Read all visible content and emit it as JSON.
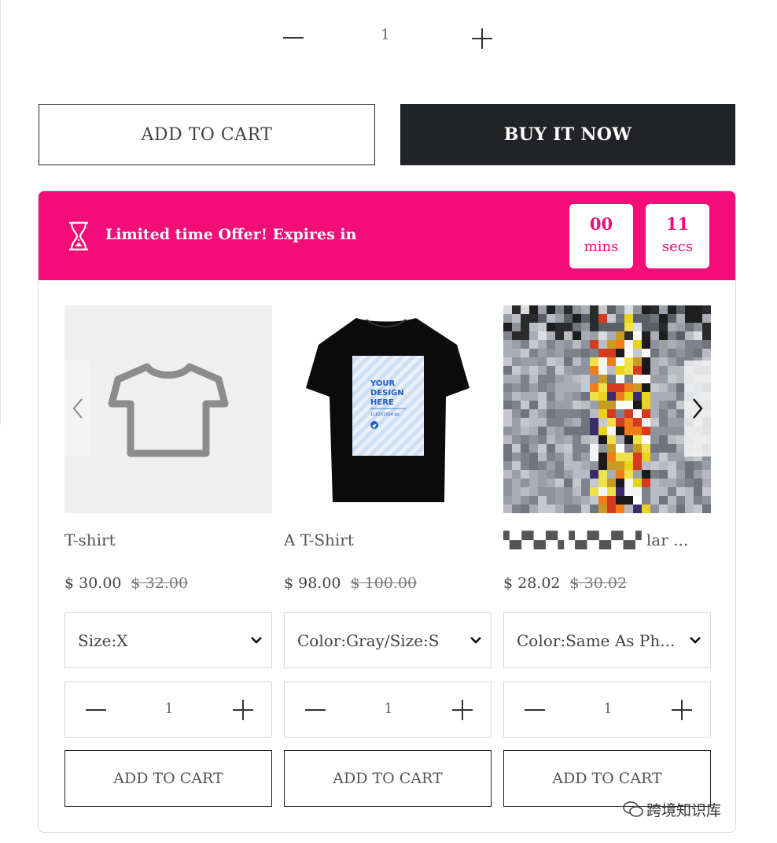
{
  "top_stepper": {
    "minus": "−",
    "quantity": "1",
    "plus": "+"
  },
  "actions": {
    "add_to_cart": "ADD TO CART",
    "buy_it_now": "BUY IT NOW"
  },
  "offer": {
    "message": "Limited time Offer! Expires in",
    "timer": {
      "minutes": "00",
      "minutes_label": "mins",
      "seconds": "11",
      "seconds_label": "secs"
    },
    "accent_color": "#f20d78"
  },
  "products": [
    {
      "title": "T-shirt",
      "price": "$ 30.00",
      "compare_price": "$ 32.00",
      "variant": "Size:X",
      "quantity": "1",
      "button": "ADD TO CART",
      "image": "tshirt-outline-placeholder"
    },
    {
      "title": "A T-Shirt",
      "price": "$ 98.00",
      "compare_price": "$ 100.00",
      "variant": "Color:Gray/Size:S",
      "quantity": "1",
      "button": "ADD TO CART",
      "image": "black-tshirt-your-design-here"
    },
    {
      "title": "▚▞▚▞▚ ▚▞▚▞▚▞ lar ...",
      "price": "$ 28.02",
      "compare_price": "$ 30.02",
      "variant": "Color:Same As Ph...",
      "quantity": "1",
      "button": "ADD TO CART",
      "image": "pixelated-photo"
    }
  ],
  "watermark": "跨境知识库"
}
